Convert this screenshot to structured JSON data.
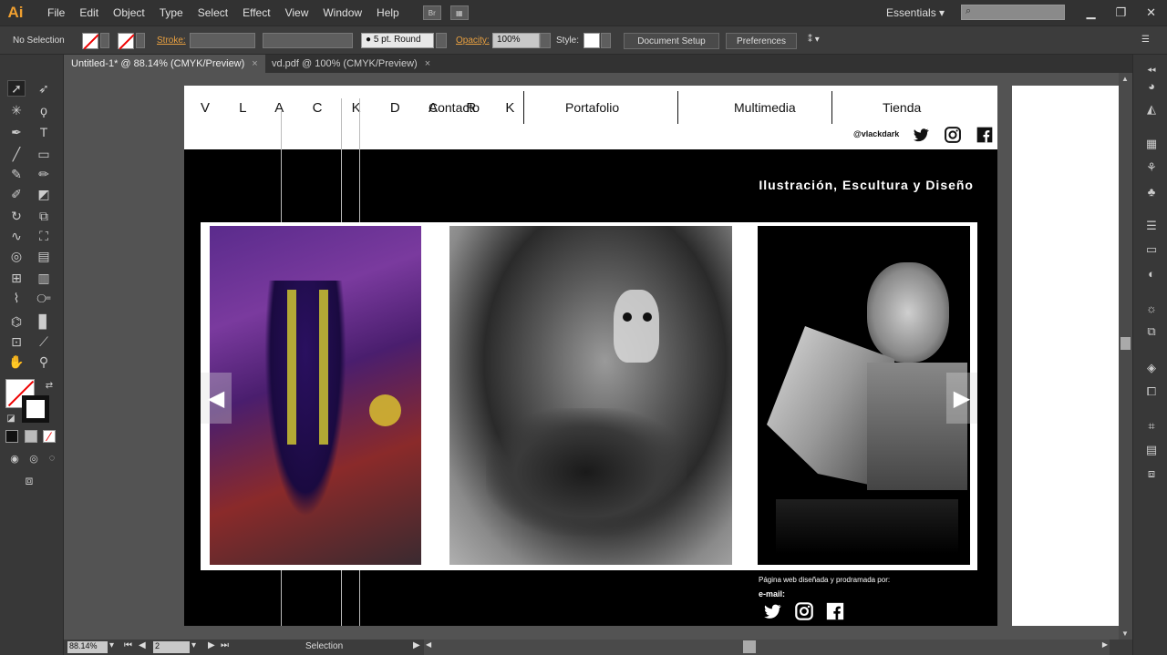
{
  "app": {
    "logo": "Ai",
    "menu": [
      "File",
      "Edit",
      "Object",
      "Type",
      "Select",
      "Effect",
      "View",
      "Window",
      "Help"
    ],
    "menu_icon_label": "Br",
    "workspace": "Essentials"
  },
  "control": {
    "selection": "No Selection",
    "stroke_label": "Stroke:",
    "brush": "5 pt. Round",
    "opacity_label": "Opacity:",
    "opacity": "100%",
    "style_label": "Style:",
    "doc_setup": "Document Setup",
    "preferences": "Preferences"
  },
  "tabs": [
    {
      "label": "Untitled-1* @ 88.14% (CMYK/Preview)"
    },
    {
      "label": "vd.pdf @ 100% (CMYK/Preview)"
    }
  ],
  "tab_close": "×",
  "status": {
    "zoom": "88.14%",
    "page": "2",
    "tool": "Selection"
  },
  "site": {
    "brand": "V L A C K D A R K",
    "nav": [
      "Contacto",
      "Portafolio",
      "Multimedia",
      "Tienda"
    ],
    "handle": "@vlackdark",
    "tagline": "Ilustración, Escultura y Diseño",
    "credit": "Página web diseñada y prodramada por:",
    "email": "e-mail:"
  },
  "icons": [
    "twitter-icon",
    "instagram-icon",
    "facebook-icon"
  ]
}
